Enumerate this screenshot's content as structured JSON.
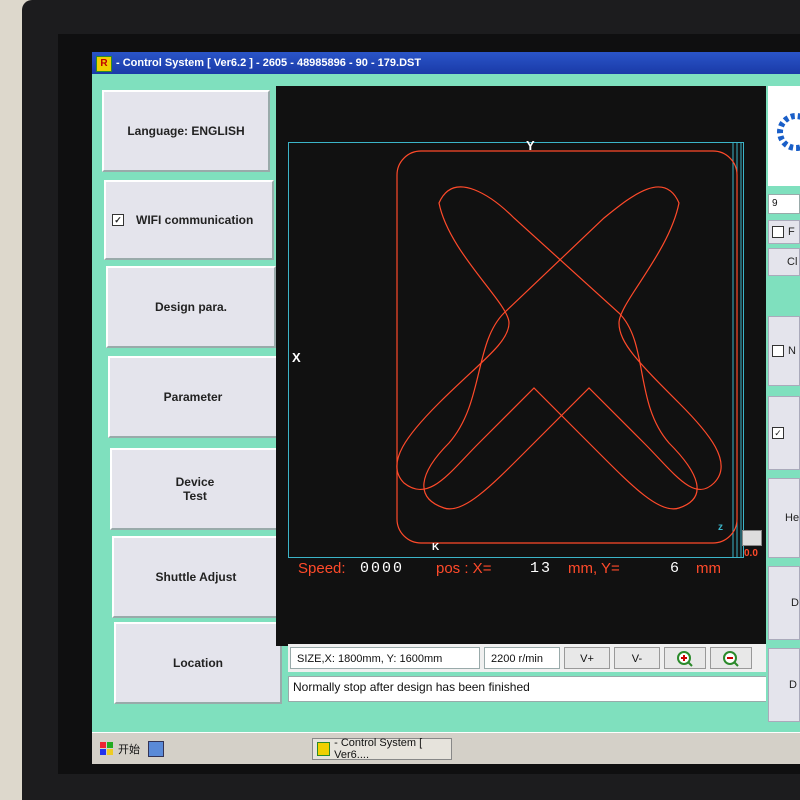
{
  "window": {
    "title": "- Control System [ Ver6.2 ] - 2605 - 48985896 - 90 - 179.DST"
  },
  "sidebar": {
    "items": [
      {
        "label": "Language: ENGLISH"
      },
      {
        "label": "WIFI communication",
        "checked": true
      },
      {
        "label": "Design para."
      },
      {
        "label": "Parameter"
      },
      {
        "label": "Device\nTest"
      },
      {
        "label": "Shuttle Adjust"
      },
      {
        "label": "Location"
      }
    ]
  },
  "canvas": {
    "axis_y": "Y",
    "axis_x": "X",
    "marker_z": "z",
    "marker_k": "K",
    "corner_value": "0.0",
    "path_color": "#ff4a2a",
    "frame_color": "#3bb4c8"
  },
  "status": {
    "speed_label": "Speed:",
    "speed_value": "0000",
    "pos_label": "pos : X=",
    "x_value": "13",
    "x_unit": "mm, Y=",
    "y_value": "6",
    "y_unit": "mm"
  },
  "bottom": {
    "size": "SIZE,X: 1800mm, Y: 1600mm",
    "rpm": "2200 r/min",
    "v_plus": "V+",
    "v_minus": "V-",
    "zoom_in_icon": "zoom-in-icon",
    "zoom_out_icon": "zoom-out-icon",
    "message": "Normally stop after design has been finished"
  },
  "right_panel": {
    "field_value": "9",
    "items": [
      "F",
      "Cl",
      "N",
      "",
      "He",
      "D",
      "D"
    ],
    "checkbox_checked": true
  },
  "taskbar": {
    "start_label": "开始",
    "task_label": "- Control System [ Ver6...."
  }
}
